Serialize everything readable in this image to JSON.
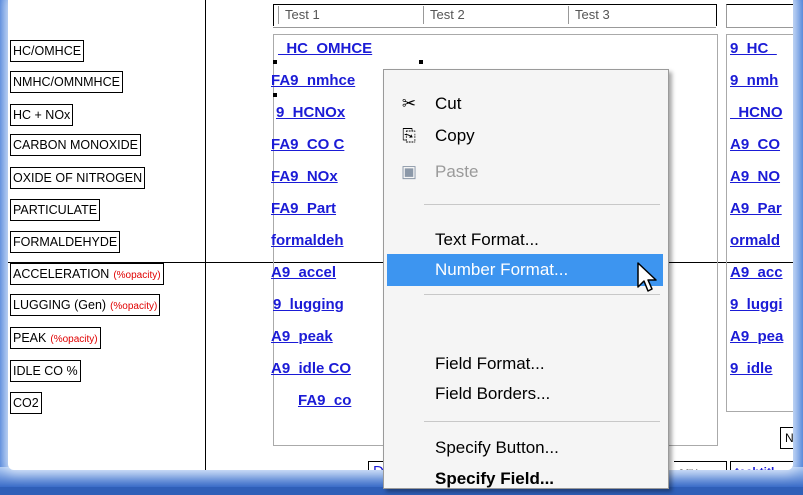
{
  "header": {
    "columns": [
      "Test 1",
      "Test 2",
      "Test 3"
    ]
  },
  "labels": [
    {
      "text": "HC/OMHCE",
      "note": ""
    },
    {
      "text": "NMHC/OMNMHCE",
      "note": ""
    },
    {
      "text": "HC + NOx",
      "note": ""
    },
    {
      "text": "CARBON MONOXIDE",
      "note": ""
    },
    {
      "text": "OXIDE OF NITROGEN",
      "note": ""
    },
    {
      "text": "PARTICULATE",
      "note": ""
    },
    {
      "text": "FORMALDEHYDE",
      "note": ""
    },
    {
      "text": "ACCELERATION",
      "note": "(%opacity)"
    },
    {
      "text": "LUGGING (Gen)",
      "note": "(%opacity)"
    },
    {
      "text": "PEAK",
      "note": "(%opacity)"
    },
    {
      "text": "IDLE CO %",
      "note": ""
    },
    {
      "text": "CO2",
      "note": ""
    }
  ],
  "fields_left": [
    "_HC_OMHCE",
    "FA9_nmhce",
    "9_HCNOx",
    "FA9_CO C",
    "FA9_NOx",
    "FA9_Part",
    "formaldeh",
    "A9_accel",
    "9_lugging",
    "A9_peak",
    "A9_idle CO",
    "FA9_co"
  ],
  "fields_right": [
    "9_HC_",
    "9_nmh",
    "_HCNO",
    "A9_CO",
    "A9_NO",
    "A9_Par",
    "ormald",
    "A9_acc",
    "9_luggi",
    "A9_pea",
    "9_idle",
    ""
  ],
  "bottom": {
    "left_text": "D",
    "mid_text": "egy",
    "right_text": "techtitl",
    "side_text": "NO"
  },
  "menu": {
    "items": [
      {
        "label": "Cut",
        "icon": "scissors-icon",
        "glyph": "✂",
        "disabled": false
      },
      {
        "label": "Copy",
        "icon": "copy-icon",
        "glyph": "⎘",
        "disabled": false
      },
      {
        "label": "Paste",
        "icon": "paste-icon",
        "glyph": "📋",
        "disabled": true
      },
      {
        "label": "Text Format...",
        "icon": "",
        "glyph": "",
        "disabled": false
      },
      {
        "label": "Number Format...",
        "icon": "",
        "glyph": "",
        "disabled": false
      },
      {
        "label": "Field Format...",
        "icon": "",
        "glyph": "",
        "disabled": false
      },
      {
        "label": "Field Borders...",
        "icon": "",
        "glyph": "",
        "disabled": false
      },
      {
        "label": "Specify Button...",
        "icon": "",
        "glyph": "",
        "disabled": false
      },
      {
        "label": "Specify Field...",
        "icon": "",
        "glyph": "",
        "disabled": false
      }
    ]
  },
  "colors": {
    "field_text": "#1b1bd6",
    "note_text": "#e00000",
    "menu_highlight": "#3d95f0",
    "frame": "#2f5fb8"
  }
}
